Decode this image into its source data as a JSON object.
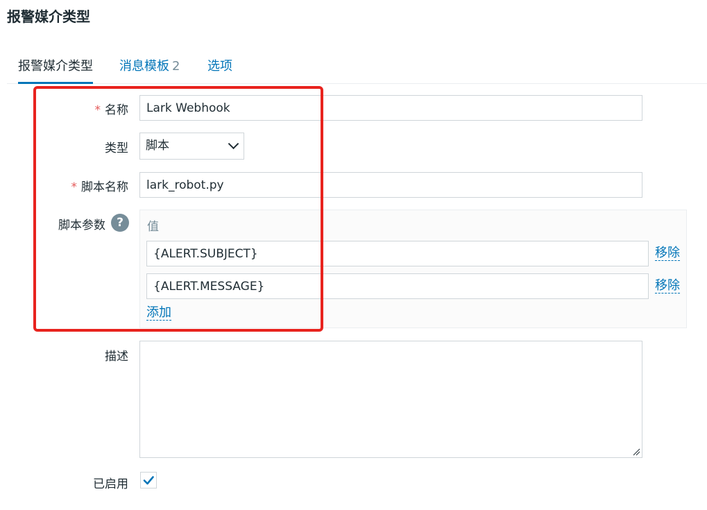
{
  "page": {
    "title": "报警媒介类型"
  },
  "tabs": [
    {
      "label": "报警媒介类型",
      "active": true
    },
    {
      "label": "消息模板",
      "count": "2"
    },
    {
      "label": "选项"
    }
  ],
  "form": {
    "name": {
      "label": "名称",
      "required_mark": "*",
      "value": "Lark Webhook"
    },
    "type": {
      "label": "类型",
      "value": "脚本"
    },
    "script_name": {
      "label": "脚本名称",
      "required_mark": "*",
      "value": "lark_robot.py"
    },
    "script_params": {
      "label": "脚本参数",
      "help_icon": "?",
      "column_header": "值",
      "rows": [
        {
          "value": "{ALERT.SUBJECT}",
          "remove_label": "移除"
        },
        {
          "value": "{ALERT.MESSAGE}",
          "remove_label": "移除"
        }
      ],
      "add_label": "添加"
    },
    "description": {
      "label": "描述",
      "value": ""
    },
    "enabled": {
      "label": "已启用",
      "checked": true
    }
  },
  "colors": {
    "accent": "#0275b8",
    "highlight_border": "#e8231e",
    "required": "#e45959",
    "muted": "#768d99"
  }
}
